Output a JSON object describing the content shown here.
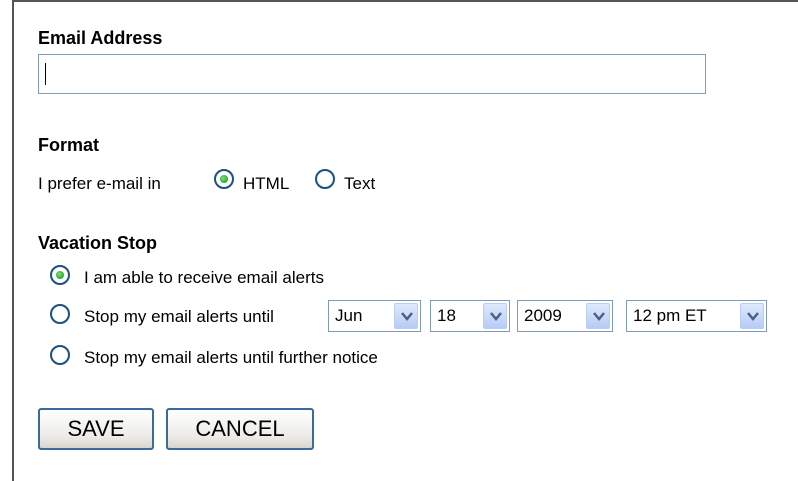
{
  "email": {
    "label": "Email Address",
    "value": ""
  },
  "format": {
    "title": "Format",
    "prompt": "I prefer e-mail in",
    "options": [
      {
        "label": "HTML",
        "checked": true
      },
      {
        "label": "Text",
        "checked": false
      }
    ]
  },
  "vacation": {
    "title": "Vacation Stop",
    "options": [
      {
        "label": "I am able to receive email alerts",
        "checked": true
      },
      {
        "label": "Stop my email alerts until",
        "checked": false
      },
      {
        "label": "Stop my email alerts until further notice",
        "checked": false
      }
    ],
    "month": "Jun",
    "day": "18",
    "year": "2009",
    "time": "12 pm ET"
  },
  "buttons": {
    "save": "SAVE",
    "cancel": "CANCEL"
  },
  "icons": {
    "dropdown": "chevron-down-icon",
    "radio_checked_color": "#2aa52a",
    "radio_border_color": "#1c5180"
  }
}
